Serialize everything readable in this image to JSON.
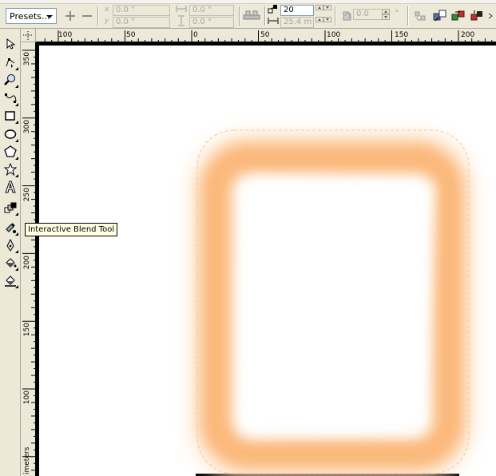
{
  "property_bar": {
    "presets_label": "Presets...",
    "x_label": "x",
    "y_label": "y",
    "offset_x": "0.0 \"",
    "offset_y": "0.0 \"",
    "size_w": "0.0 \"",
    "size_h": "0.0 \"",
    "blend_steps": "20",
    "blend_spacing": "25.4 m",
    "rotation": "0.0",
    "degree_symbol": "°"
  },
  "toolbox": {
    "tools": [
      {
        "name": "pick-tool-icon"
      },
      {
        "name": "shape-tool-icon"
      },
      {
        "name": "zoom-tool-icon"
      },
      {
        "name": "freehand-tool-icon"
      },
      {
        "name": "rectangle-tool-icon"
      },
      {
        "name": "ellipse-tool-icon"
      },
      {
        "name": "polygon-tool-icon"
      },
      {
        "name": "star-tool-icon"
      },
      {
        "name": "text-tool-icon"
      },
      {
        "name": "interactive-blend-tool-icon"
      },
      {
        "name": "eyedropper-tool-icon"
      },
      {
        "name": "outline-pen-tool-icon"
      },
      {
        "name": "fill-tool-icon"
      },
      {
        "name": "interactive-fill-tool-icon"
      }
    ]
  },
  "tooltip": {
    "text": "Interactive Blend Tool"
  },
  "ruler": {
    "horizontal_ticks": [
      "100",
      "50",
      "0",
      "50",
      "100",
      "150",
      "200"
    ],
    "vertical_ticks": [
      "350",
      "300",
      "250",
      "200",
      "150",
      "100"
    ],
    "unit_label": "imeters"
  },
  "colors": {
    "blend_edge": "#fbb87a",
    "blend_fade": "#ffe6cc",
    "ui_background": "#ece9d8"
  }
}
